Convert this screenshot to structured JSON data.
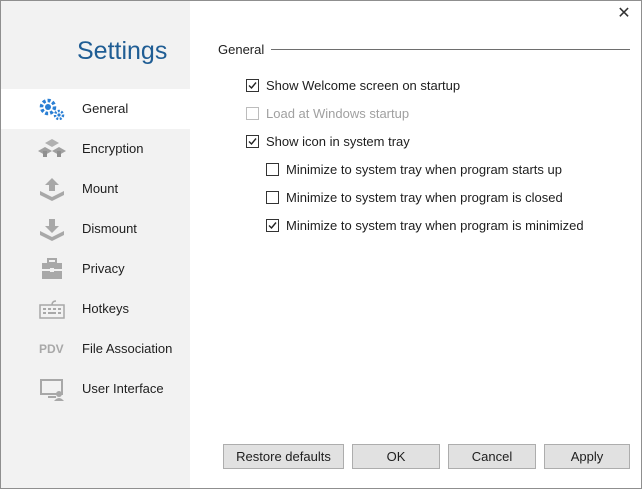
{
  "window": {
    "close_symbol": "✕"
  },
  "sidebar": {
    "title": "Settings",
    "items": [
      {
        "label": "General",
        "icon": "gears-icon",
        "active": true
      },
      {
        "label": "Encryption",
        "icon": "encryption-icon"
      },
      {
        "label": "Mount",
        "icon": "mount-icon"
      },
      {
        "label": "Dismount",
        "icon": "dismount-icon"
      },
      {
        "label": "Privacy",
        "icon": "privacy-icon"
      },
      {
        "label": "Hotkeys",
        "icon": "keyboard-icon"
      },
      {
        "label": "File Association",
        "icon": "pdv-icon",
        "icon_text": "PDV"
      },
      {
        "label": "User Interface",
        "icon": "user-interface-icon"
      }
    ]
  },
  "general": {
    "group_label": "General",
    "options": [
      {
        "label": "Show Welcome screen on startup",
        "checked": true,
        "enabled": true
      },
      {
        "label": "Load at Windows startup",
        "checked": false,
        "enabled": false
      },
      {
        "label": "Show icon in system tray",
        "checked": true,
        "enabled": true
      },
      {
        "label": "Minimize to system tray when program starts up",
        "checked": false,
        "enabled": true
      },
      {
        "label": "Minimize to system tray when program is closed",
        "checked": false,
        "enabled": true
      },
      {
        "label": "Minimize to system tray when program is minimized",
        "checked": true,
        "enabled": true
      }
    ]
  },
  "footer": {
    "restore_label": "Restore defaults",
    "ok_label": "OK",
    "cancel_label": "Cancel",
    "apply_label": "Apply"
  },
  "colors": {
    "accent": "#1f5d94",
    "icon_blue": "#2a7fd4",
    "icon_gray": "#a8a8a8"
  }
}
